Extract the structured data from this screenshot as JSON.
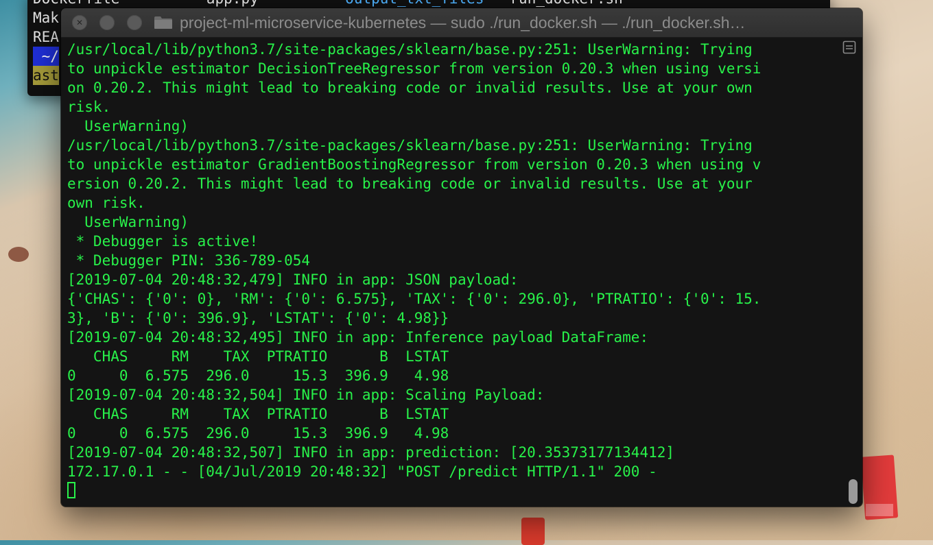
{
  "background_terminal": {
    "rows": [
      {
        "a": "Dockerfile",
        "b": "app.py",
        "c": "output_txt_files",
        "d": "run_docker.sh"
      },
      {
        "a": "Mak"
      },
      {
        "a": "REA"
      }
    ],
    "prompt_fragment": " ~/",
    "ast_fragment": "ast"
  },
  "window": {
    "title": "project-ml-microservice-kubernetes — sudo ./run_docker.sh — ./run_docker.sh…"
  },
  "terminal": {
    "lines": [
      "/usr/local/lib/python3.7/site-packages/sklearn/base.py:251: UserWarning: Trying",
      "to unpickle estimator DecisionTreeRegressor from version 0.20.3 when using versi",
      "on 0.20.2. This might lead to breaking code or invalid results. Use at your own",
      "risk.",
      "  UserWarning)",
      "/usr/local/lib/python3.7/site-packages/sklearn/base.py:251: UserWarning: Trying",
      "to unpickle estimator GradientBoostingRegressor from version 0.20.3 when using v",
      "ersion 0.20.2. This might lead to breaking code or invalid results. Use at your",
      "own risk.",
      "  UserWarning)",
      " * Debugger is active!",
      " * Debugger PIN: 336-789-054",
      "[2019-07-04 20:48:32,479] INFO in app: JSON payload:",
      "{'CHAS': {'0': 0}, 'RM': {'0': 6.575}, 'TAX': {'0': 296.0}, 'PTRATIO': {'0': 15.",
      "3}, 'B': {'0': 396.9}, 'LSTAT': {'0': 4.98}}",
      "[2019-07-04 20:48:32,495] INFO in app: Inference payload DataFrame:",
      "   CHAS     RM    TAX  PTRATIO      B  LSTAT",
      "0     0  6.575  296.0     15.3  396.9   4.98",
      "[2019-07-04 20:48:32,504] INFO in app: Scaling Payload:",
      "   CHAS     RM    TAX  PTRATIO      B  LSTAT",
      "0     0  6.575  296.0     15.3  396.9   4.98",
      "[2019-07-04 20:48:32,507] INFO in app: prediction: [20.35373177134412]",
      "172.17.0.1 - - [04/Jul/2019 20:48:32] \"POST /predict HTTP/1.1\" 200 -"
    ]
  },
  "colors": {
    "terminal_text": "#28f24a",
    "terminal_bg": "#141414",
    "titlebar": "#333333"
  },
  "icons": {
    "close": "close-icon",
    "minimize": "minimize-icon",
    "zoom": "zoom-icon",
    "folder": "folder-icon",
    "scroll_toggle": "scroll-toggle-icon"
  }
}
